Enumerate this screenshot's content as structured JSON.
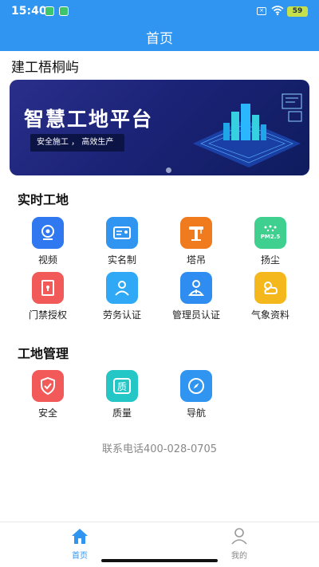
{
  "status_bar": {
    "time": "15:40",
    "battery": "59"
  },
  "header": {
    "title": "首页"
  },
  "site_name": "建工梧桐屿",
  "banner": {
    "title": "智慧工地平台",
    "tagline": "安全施工 ， 高效生产"
  },
  "sections": {
    "realtime": {
      "title": "实时工地",
      "items": [
        {
          "label": "视频",
          "icon": "video-camera-icon",
          "color": "#2f78f0"
        },
        {
          "label": "实名制",
          "icon": "id-card-icon",
          "color": "#2f95f1"
        },
        {
          "label": "塔吊",
          "icon": "tower-crane-icon",
          "color": "#f07b1e"
        },
        {
          "label": "扬尘",
          "icon": "dust-pm25-icon",
          "color": "#3fcf8e"
        },
        {
          "label": "门禁授权",
          "icon": "door-access-icon",
          "color": "#f25a5a"
        },
        {
          "label": "劳务认证",
          "icon": "worker-icon",
          "color": "#2fa8f5"
        },
        {
          "label": "管理员认证",
          "icon": "admin-user-icon",
          "color": "#2f8df1"
        },
        {
          "label": "气象资料",
          "icon": "weather-icon",
          "color": "#f5b81c"
        }
      ]
    },
    "management": {
      "title": "工地管理",
      "items": [
        {
          "label": "安全",
          "icon": "shield-check-icon",
          "color": "#f25a5a"
        },
        {
          "label": "质量",
          "icon": "quality-icon",
          "color": "#24c6c6"
        },
        {
          "label": "导航",
          "icon": "compass-icon",
          "color": "#2f95f1"
        }
      ]
    }
  },
  "contact": "联系电话400-028-0705",
  "tabbar": {
    "home": "首页",
    "mine": "我的"
  }
}
